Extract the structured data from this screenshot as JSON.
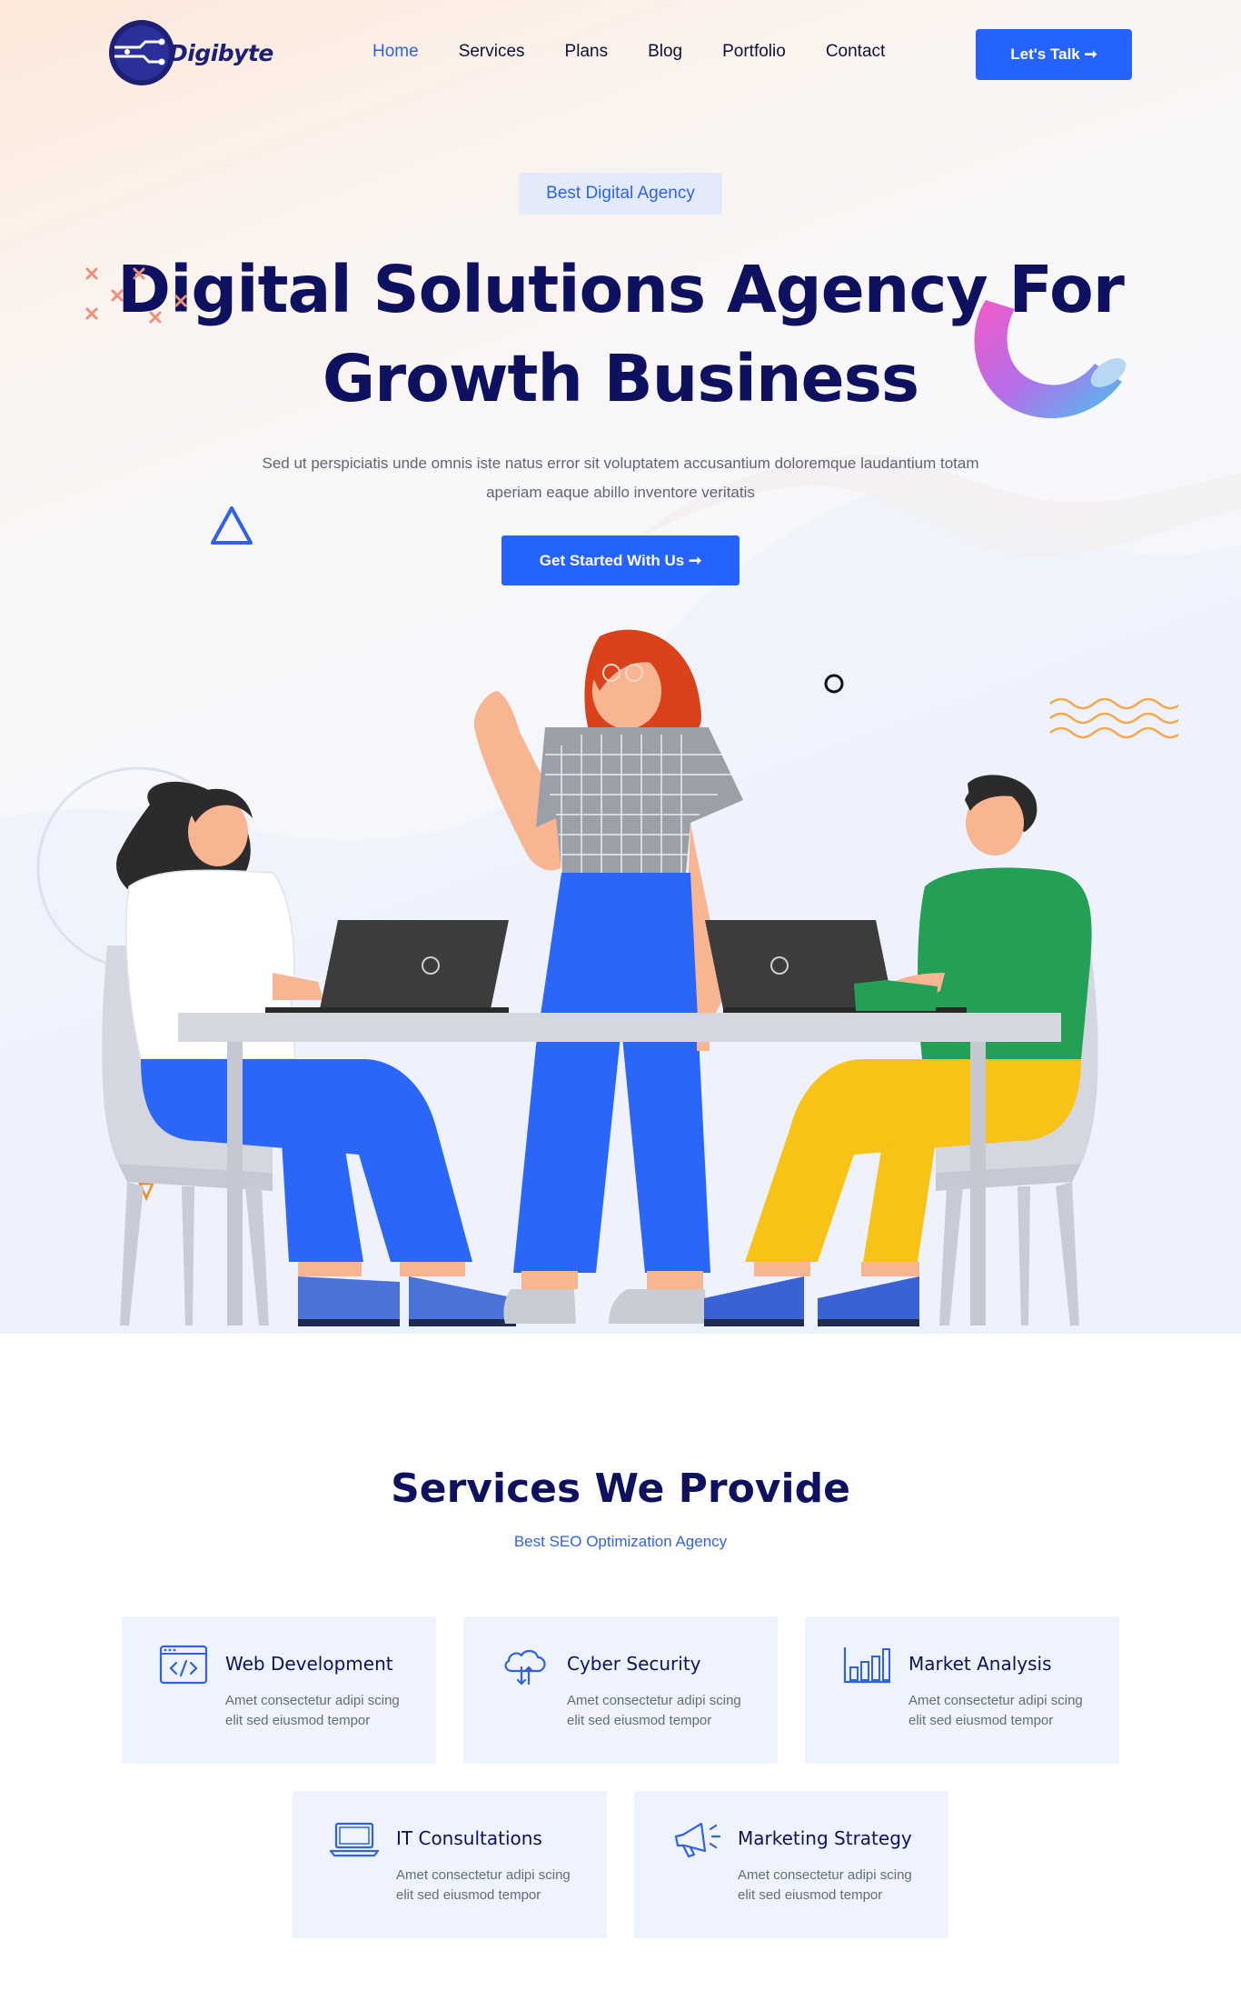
{
  "brand": {
    "name": "Digibyte",
    "logo_text": "Digibyte"
  },
  "nav": {
    "links": [
      {
        "label": "Home",
        "active": true
      },
      {
        "label": "Services",
        "active": false
      },
      {
        "label": "Plans",
        "active": false
      },
      {
        "label": "Blog",
        "active": false
      },
      {
        "label": "Portfolio",
        "active": false
      },
      {
        "label": "Contact",
        "active": false
      }
    ],
    "cta_label": "Let's Talk ➞"
  },
  "hero": {
    "badge": "Best Digital Agency",
    "title_line1": "Digital Solutions Agency For",
    "title_line2": "Growth Business",
    "subtitle_line1": "Sed ut perspiciatis unde omnis iste natus error sit voluptatem accusantium doloremque laudantium totam",
    "subtitle_line2": "aperiam eaque abillo inventore veritatis",
    "cta_label": "Get Started With Us ➞"
  },
  "services": {
    "title": "Services We Provide",
    "subtitle": "Best SEO Optimization Agency",
    "items": [
      {
        "title": "Web Development",
        "text": "Amet consectetur adipi scing elit sed eiusmod tempor",
        "icon": "code-window-icon"
      },
      {
        "title": "Cyber Security",
        "text": "Amet consectetur adipi scing elit sed eiusmod tempor",
        "icon": "cloud-transfer-icon"
      },
      {
        "title": "Market Analysis",
        "text": "Amet consectetur adipi scing elit sed eiusmod tempor",
        "icon": "bar-chart-icon"
      },
      {
        "title": "IT Consultations",
        "text": "Amet consectetur adipi scing elit sed eiusmod tempor",
        "icon": "laptop-icon"
      },
      {
        "title": "Marketing Strategy",
        "text": "Amet consectetur adipi scing elit sed eiusmod tempor",
        "icon": "megaphone-icon"
      }
    ]
  },
  "colors": {
    "primary": "#2563ff",
    "heading": "#0d1160",
    "card_bg": "#eef3fd",
    "badge_bg": "#e3ebfb"
  }
}
